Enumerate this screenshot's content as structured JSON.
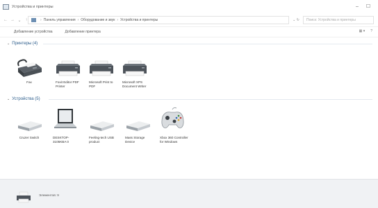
{
  "window": {
    "title": "Устройства и принтеры",
    "minimize": "–",
    "maximize": "☐"
  },
  "nav": {
    "back": "←",
    "forward": "→",
    "recent": "⌄",
    "up": "↑",
    "breadcrumb": [
      "Панель управления",
      "Оборудование и звук",
      "Устройства и принтеры"
    ],
    "refresh": "⌄ ↻",
    "search_placeholder": "Поиск: Устройства и принтеры"
  },
  "commands": {
    "add_device": "Добавление устройства",
    "add_printer": "Добавление принтера",
    "view": "▦ ▾",
    "help": "?"
  },
  "groups": {
    "printers": {
      "title": "Принтеры (4)",
      "items": [
        {
          "label": "Fax",
          "icon": "fax-printer-icon"
        },
        {
          "label": "Foxit Editor PDF Printer",
          "icon": "printer-icon"
        },
        {
          "label": "Microsoft Print to PDF",
          "icon": "printer-icon"
        },
        {
          "label": "Microsoft XPS Document Writer",
          "icon": "printer-icon"
        }
      ]
    },
    "devices": {
      "title": "Устройства (5)",
      "items": [
        {
          "label": "Cruzer Switch",
          "icon": "usb-drive-icon"
        },
        {
          "label": "DESKTOP-3105KBA 0",
          "icon": "laptop-icon"
        },
        {
          "label": "Feeling-tech USB product",
          "icon": "usb-device-icon"
        },
        {
          "label": "Mass Storage Device",
          "icon": "usb-drive-icon"
        },
        {
          "label": "Xbox 360 Controller for Windows",
          "icon": "gamepad-icon"
        }
      ]
    }
  },
  "details": {
    "text": "Элементов: 9"
  }
}
